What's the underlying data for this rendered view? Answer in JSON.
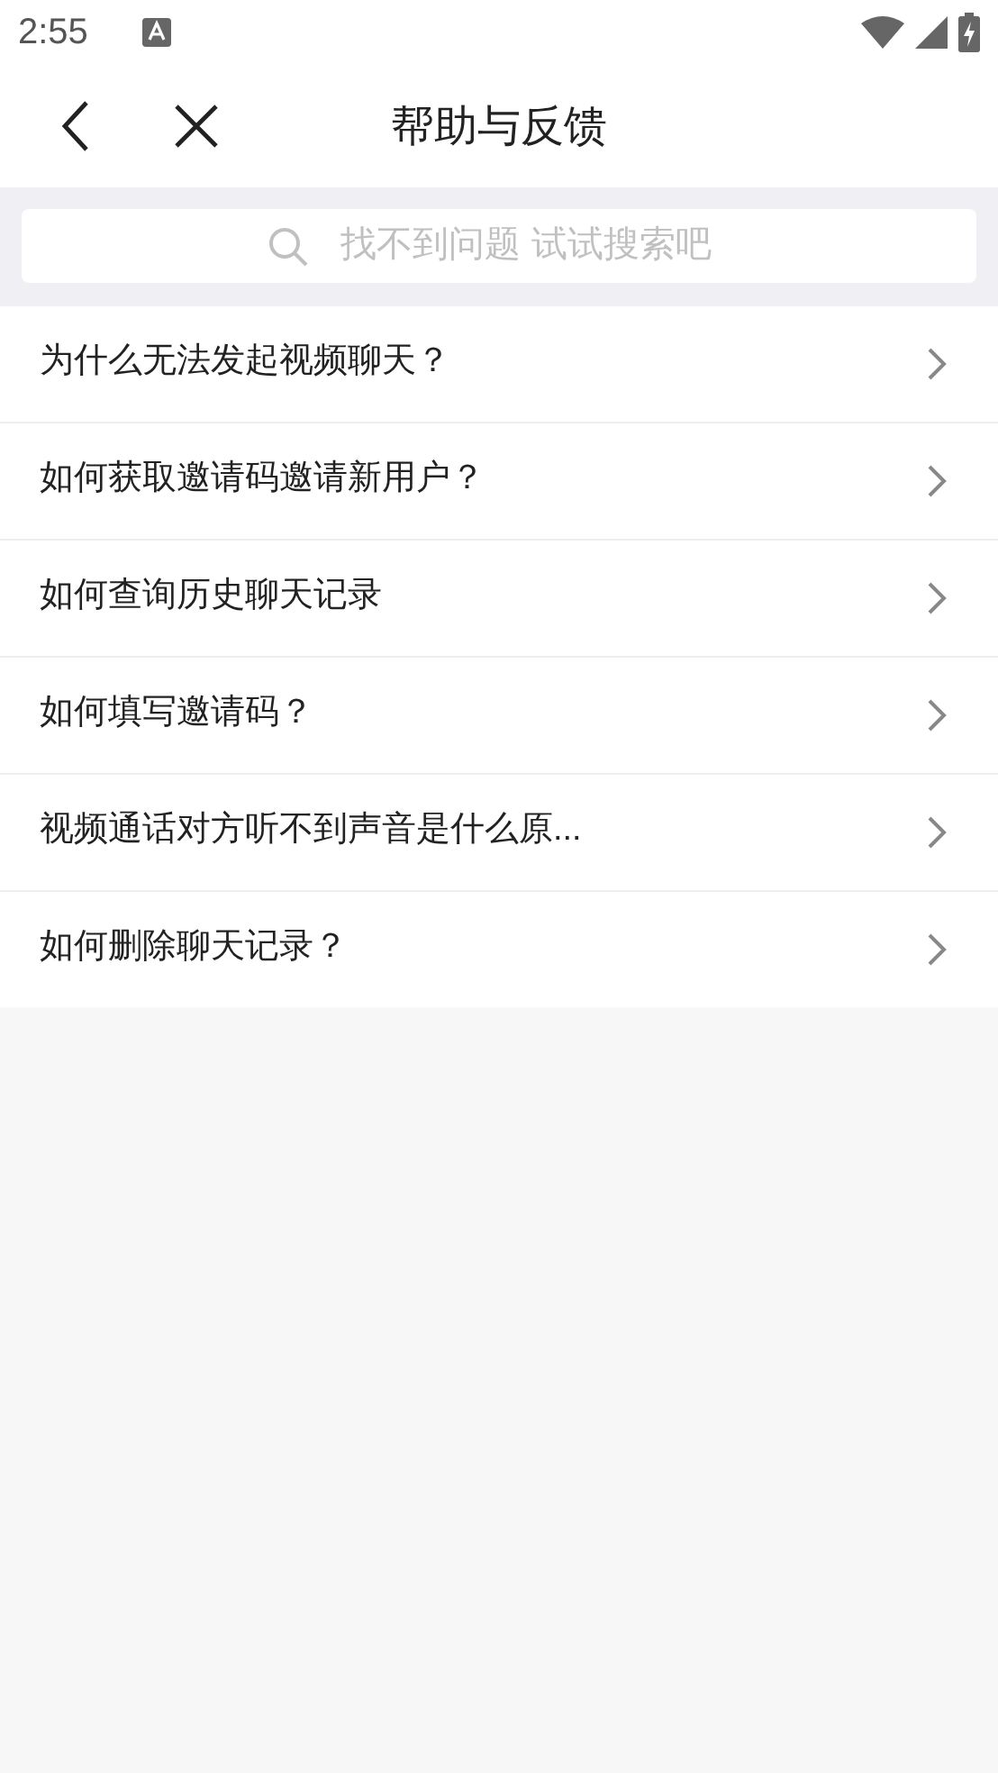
{
  "status_bar": {
    "time": "2:55"
  },
  "header": {
    "title": "帮助与反馈"
  },
  "search": {
    "placeholder": "找不到问题 试试搜索吧"
  },
  "questions": [
    {
      "text": "为什么无法发起视频聊天？"
    },
    {
      "text": "如何获取邀请码邀请新用户？"
    },
    {
      "text": "如何查询历史聊天记录"
    },
    {
      "text": "如何填写邀请码？"
    },
    {
      "text": "视频通话对方听不到声音是什么原..."
    },
    {
      "text": "如何删除聊天记录？"
    }
  ]
}
